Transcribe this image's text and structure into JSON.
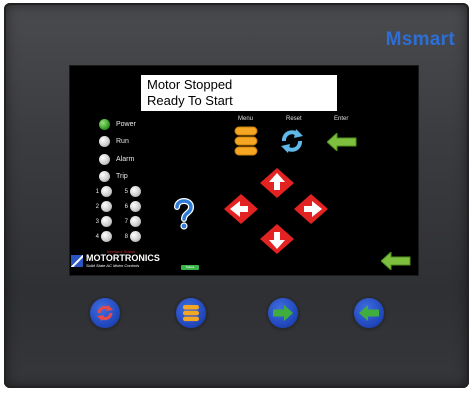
{
  "brand": "Msmart",
  "display": {
    "message_line1": "Motor Stopped",
    "message_line2": "Ready To Start"
  },
  "indicators": [
    {
      "label": "Power",
      "on": true
    },
    {
      "label": "Run",
      "on": false
    },
    {
      "label": "Alarm",
      "on": false
    },
    {
      "label": "Trip",
      "on": false
    }
  ],
  "numbered_leds": [
    "1",
    "2",
    "3",
    "4",
    "5",
    "6",
    "7",
    "8"
  ],
  "status_caption": "Interface Status",
  "buttons": {
    "menu": "Menu",
    "reset": "Reset",
    "enter": "Enter"
  },
  "logo": {
    "name": "MOTORTRONICS",
    "tagline": "Solid State AC Motor Controls"
  },
  "indicator_bar_label": "Status",
  "icons": {
    "menu": "stack-icon",
    "reset": "refresh-icon",
    "enter": "enter-arrow-icon",
    "help": "question-mark-icon",
    "arrows": [
      "up-arrow-icon",
      "left-arrow-icon",
      "right-arrow-icon",
      "down-arrow-icon"
    ]
  },
  "colors": {
    "brand": "#2d6fd6",
    "arrow_red": "#e32222",
    "menu_orange": "#f5a623",
    "enter_green": "#7fbf3f",
    "hw_button_blue": "#1e44b8"
  }
}
